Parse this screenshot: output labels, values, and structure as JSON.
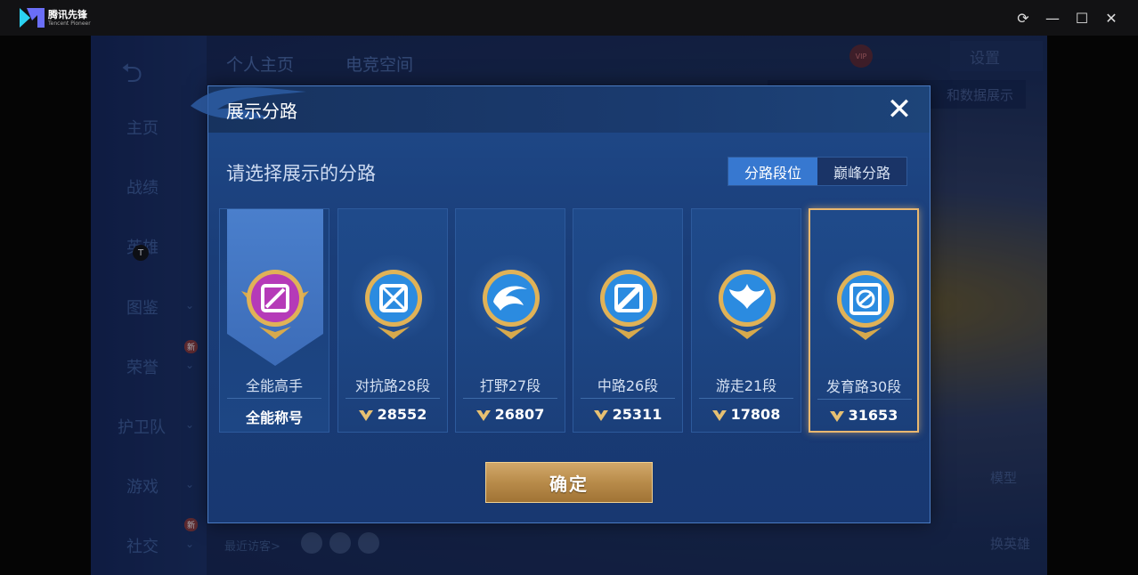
{
  "emulator": {
    "app_name": "腾讯先锋",
    "app_name_en": "Tencent Pioneer",
    "controls": [
      "refresh-icon",
      "minimize-icon",
      "maximize-icon",
      "close-icon"
    ]
  },
  "background": {
    "tabs": [
      "个人主页",
      "电竞空间"
    ],
    "nav": [
      "主页",
      "战绩",
      "英雄",
      "图鉴",
      "荣誉",
      "护卫队",
      "游戏",
      "社交"
    ],
    "new_badge": "新",
    "t_marker": "T",
    "settings": "设置",
    "data_display": "和数据展示",
    "vip": "VIP",
    "recent_visitors": "最近访客>",
    "model": "模型",
    "change_hero": "换英雄"
  },
  "dialog": {
    "title": "展示分路",
    "subtitle": "请选择展示的分路",
    "segments": [
      "分路段位",
      "巅峰分路"
    ],
    "active_segment": 0,
    "confirm": "确定",
    "cards": [
      {
        "name": "全能高手",
        "score": "全能称号",
        "icon": "all-round-badge-icon",
        "selected": false
      },
      {
        "name": "对抗路28段",
        "score": "28552",
        "icon": "clash-lane-badge-icon",
        "selected": false
      },
      {
        "name": "打野27段",
        "score": "26807",
        "icon": "jungle-badge-icon",
        "selected": false
      },
      {
        "name": "中路26段",
        "score": "25311",
        "icon": "mid-lane-badge-icon",
        "selected": false
      },
      {
        "name": "游走21段",
        "score": "17808",
        "icon": "roam-badge-icon",
        "selected": false
      },
      {
        "name": "发育路30段",
        "score": "31653",
        "icon": "farm-lane-badge-icon",
        "selected": true
      }
    ]
  },
  "colors": {
    "accent_blue": "#3778d0",
    "gold": "#e9b870",
    "badge_purple": "#b53ab8"
  }
}
